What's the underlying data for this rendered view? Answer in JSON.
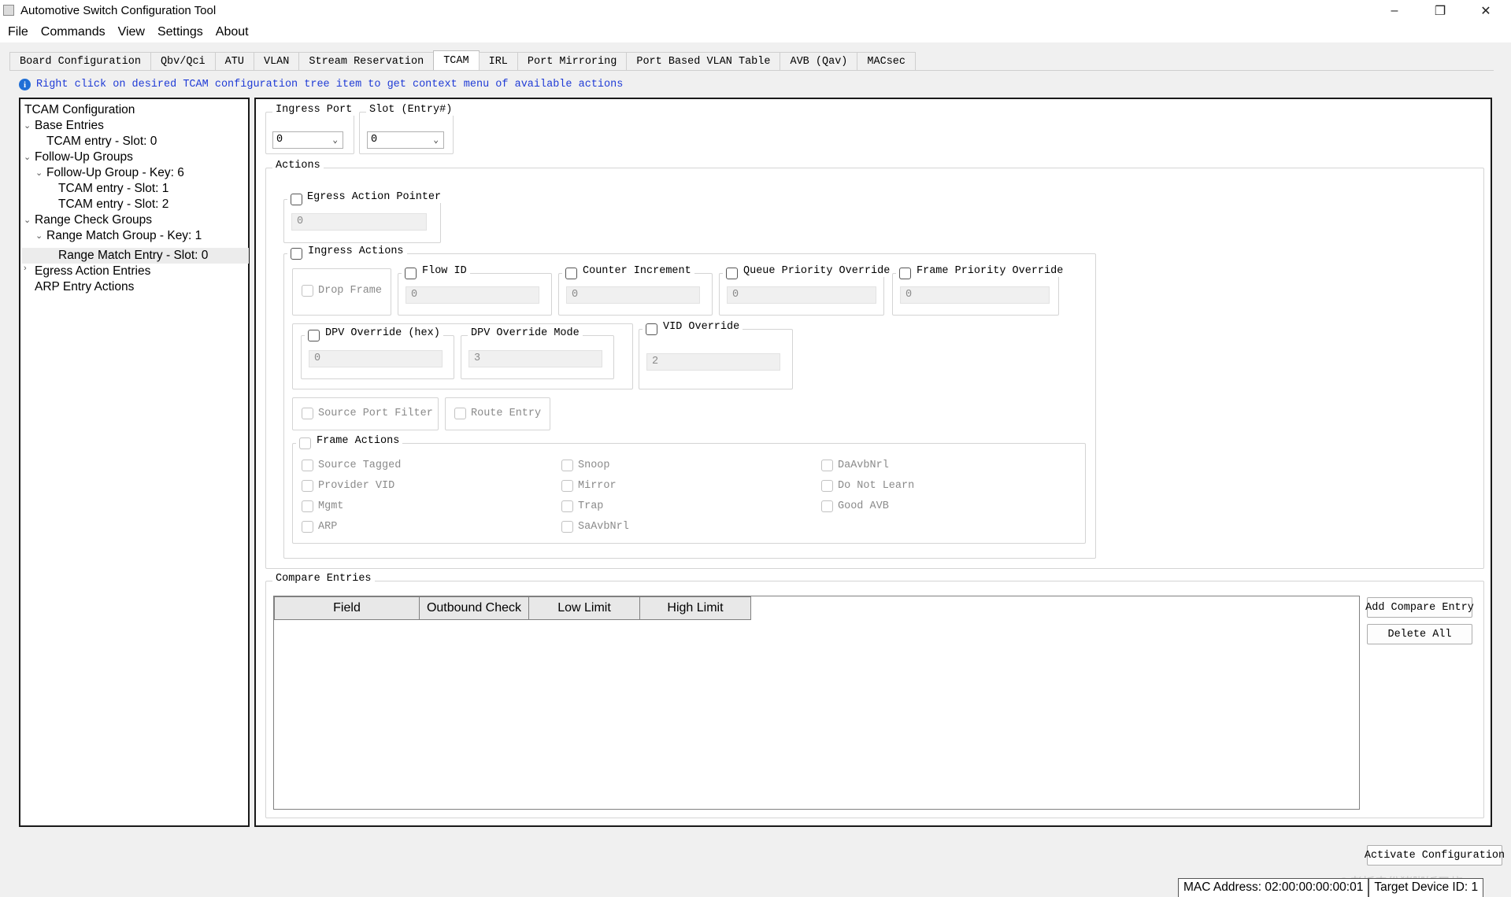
{
  "window": {
    "title": "Automotive Switch Configuration Tool",
    "minimize": "–",
    "maximize": "❐",
    "close": "✕"
  },
  "menu": [
    "File",
    "Commands",
    "View",
    "Settings",
    "About"
  ],
  "tabs": [
    "Board Configuration",
    "Qbv/Qci",
    "ATU",
    "VLAN",
    "Stream Reservation",
    "TCAM",
    "IRL",
    "Port Mirroring",
    "Port Based VLAN Table",
    "AVB (Qav)",
    "MACsec"
  ],
  "active_tab": "TCAM",
  "hint": "Right click on desired TCAM configuration tree item to get context menu of available actions",
  "tree": {
    "root": "TCAM Configuration",
    "items": [
      "Base Entries",
      "TCAM entry - Slot: 0",
      "Follow-Up Groups",
      "Follow-Up Group - Key: 6",
      "TCAM entry - Slot: 1",
      "TCAM entry - Slot: 2",
      "Range Check Groups",
      "Range Match Group - Key: 1",
      "Range Match Entry - Slot: 0",
      "Egress Action Entries",
      "ARP Entry Actions"
    ]
  },
  "ingress_port": {
    "label": "Ingress Port",
    "value": "0"
  },
  "slot": {
    "label": "Slot (Entry#)",
    "value": "0"
  },
  "actions": {
    "title": "Actions",
    "egress_action_pointer": {
      "label": "Egress Action Pointer",
      "value": "0"
    },
    "ingress_actions": {
      "label": "Ingress Actions",
      "drop_frame": "Drop Frame",
      "flow_id": {
        "label": "Flow ID",
        "value": "0"
      },
      "counter_increment": {
        "label": "Counter Increment",
        "value": "0"
      },
      "queue_priority_override": {
        "label": "Queue Priority Override",
        "value": "0"
      },
      "frame_priority_override": {
        "label": "Frame Priority Override",
        "value": "0"
      },
      "dpv_override": {
        "label": "DPV Override (hex)",
        "value": "0"
      },
      "dpv_override_mode": {
        "label": "DPV Override Mode",
        "value": "3"
      },
      "vid_override": {
        "label": "VID Override",
        "value": "2"
      },
      "source_port_filter": "Source Port Filter",
      "route_entry": "Route Entry",
      "frame_actions": {
        "label": "Frame Actions",
        "col1": [
          "Source Tagged",
          "Provider VID",
          "Mgmt",
          "ARP"
        ],
        "col2": [
          "Snoop",
          "Mirror",
          "Trap",
          "SaAvbNrl"
        ],
        "col3": [
          "DaAvbNrl",
          "Do Not Learn",
          "Good AVB"
        ]
      }
    }
  },
  "compare": {
    "title": "Compare Entries",
    "columns": [
      "Field",
      "Outbound Check",
      "Low Limit",
      "High Limit"
    ],
    "add_button": "Add Compare Entry",
    "delete_button": "Delete All"
  },
  "activate_button": "Activate Configuration",
  "status": {
    "mac": "MAC Address: 02:00:00:00:00:01",
    "device": "Target Device ID: 1"
  },
  "watermark": "CSDN @老板来份猪脚饭又烧"
}
